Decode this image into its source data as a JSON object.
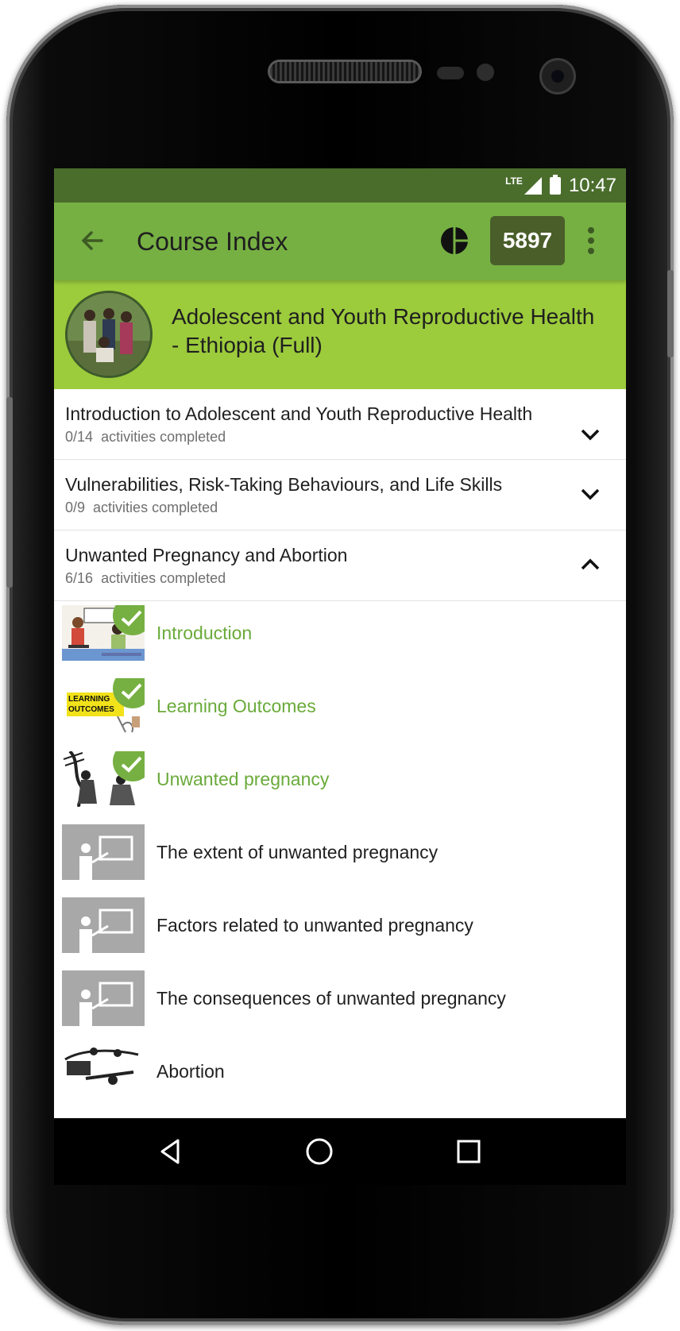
{
  "status_bar": {
    "network": "LTE",
    "time": "10:47"
  },
  "app_bar": {
    "title": "Course Index",
    "points": "5897"
  },
  "course": {
    "title": "Adolescent and Youth Reproductive Health - Ethiopia (Full)"
  },
  "sections": [
    {
      "title": "Introduction to Adolescent and Youth Reproductive Health",
      "progress": "0/14",
      "progress_suffix": "activities completed",
      "expanded": false
    },
    {
      "title": "Vulnerabilities, Risk-Taking Behaviours, and Life Skills",
      "progress": "0/9",
      "progress_suffix": "activities completed",
      "expanded": false
    },
    {
      "title": "Unwanted Pregnancy and Abortion",
      "progress": "6/16",
      "progress_suffix": "activities completed",
      "expanded": true
    }
  ],
  "activities": [
    {
      "label": "Introduction",
      "completed": true,
      "thumb": "classroom-illustration"
    },
    {
      "label": "Learning Outcomes",
      "completed": true,
      "thumb": "learning-outcomes-sign"
    },
    {
      "label": "Unwanted pregnancy",
      "completed": true,
      "thumb": "sketch-illustration"
    },
    {
      "label": "The extent of unwanted pregnancy",
      "completed": false,
      "thumb": "teacher-board-icon"
    },
    {
      "label": "Factors related to unwanted pregnancy",
      "completed": false,
      "thumb": "teacher-board-icon"
    },
    {
      "label": "The consequences of unwanted pregnancy",
      "completed": false,
      "thumb": "teacher-board-icon"
    },
    {
      "label": "Abortion",
      "completed": false,
      "thumb": "sketch-illustration"
    }
  ],
  "thumb_text": {
    "learning_outcomes": "LEARNING OUTCOMES"
  },
  "colors": {
    "status_bar": "#4a6d2c",
    "app_bar": "#76b043",
    "course_header": "#9ccb3c",
    "points_badge": "#4a5e2a",
    "completed_text": "#6aaa3a"
  }
}
